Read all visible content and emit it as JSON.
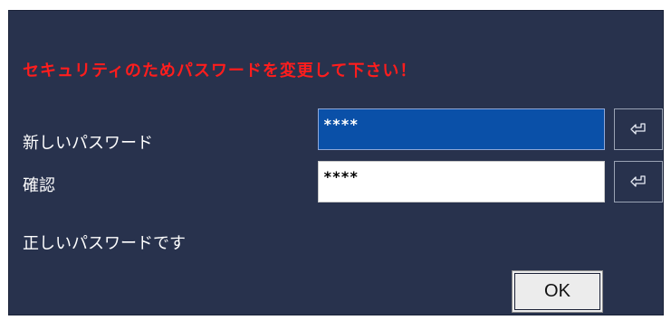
{
  "dialog": {
    "warning_message": "セキュリティのためパスワードを変更して下さい！",
    "new_password_label": "新しいパスワード",
    "new_password_value": "****",
    "confirm_label": "確認",
    "confirm_value": "****",
    "status_message": "正しいパスワードです",
    "ok_label": "OK",
    "enter_key_icon": "enter-key-icon"
  },
  "colors": {
    "background": "#28324d",
    "warning_text": "#ff1d1d",
    "active_field": "#0a50a8"
  }
}
